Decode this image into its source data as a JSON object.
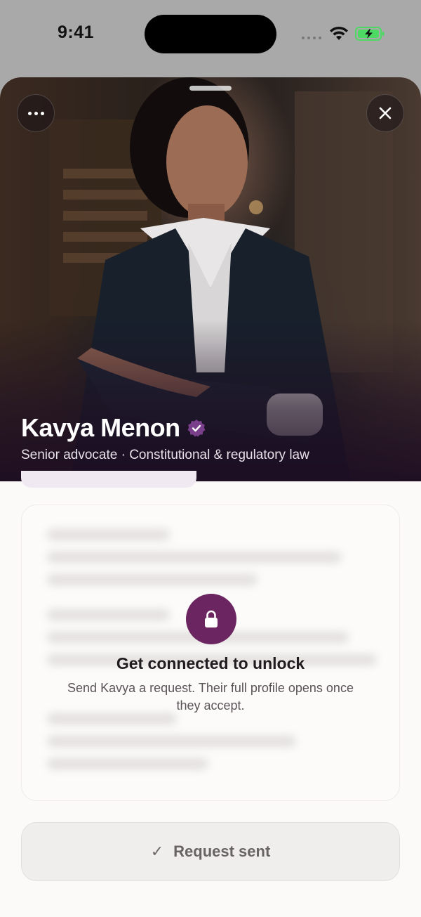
{
  "status_bar": {
    "time": "9:41",
    "battery_color": "#4cd964"
  },
  "profile": {
    "name": "Kavya Menon",
    "subtitle": "Senior advocate · Constitutional & regulatory law",
    "verified": true,
    "photo_description_icon": "profile-photo"
  },
  "lock": {
    "title": "Get connected to unlock",
    "message": "Send Kavya a request. Their full profile opens once they accept."
  },
  "request_button": {
    "icon": "check-icon",
    "label": "Request sent"
  },
  "colors": {
    "accent": "#6b2560",
    "verified_badge": "#7a3f8a"
  }
}
